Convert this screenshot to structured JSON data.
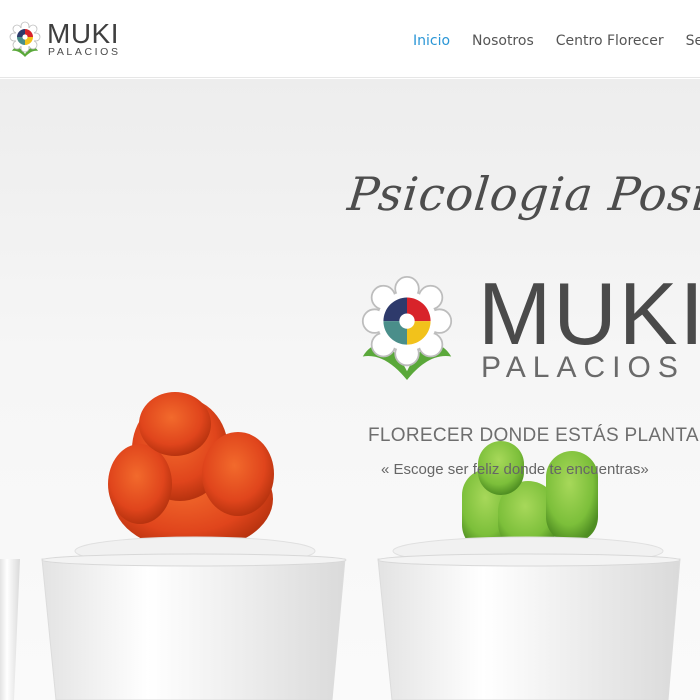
{
  "header": {
    "logo": {
      "name": "MUKI",
      "subname": "PALACIOS"
    },
    "nav": [
      {
        "label": "Inicio",
        "active": true
      },
      {
        "label": "Nosotros",
        "active": false
      },
      {
        "label": "Centro Florecer",
        "active": false
      },
      {
        "label": "Se",
        "active": false
      }
    ]
  },
  "hero": {
    "tagline": "Psicologia Positiva",
    "logo": {
      "name": "MUKI",
      "subname": "PALACIOS"
    },
    "headline": "FLORECER DONDE ESTÁS PLANTADO",
    "quote": "« Escoge ser feliz donde te encuentras»"
  },
  "colors": {
    "accent": "#2a96d6",
    "text": "#555555",
    "logo_navy": "#2e3a6b",
    "logo_red": "#d8232a",
    "logo_yellow": "#f2c21b",
    "logo_teal": "#4a8e8a",
    "leaf_green": "#5aa83a",
    "cactus_orange": "#e0451c",
    "cactus_green": "#7cbf3a"
  }
}
